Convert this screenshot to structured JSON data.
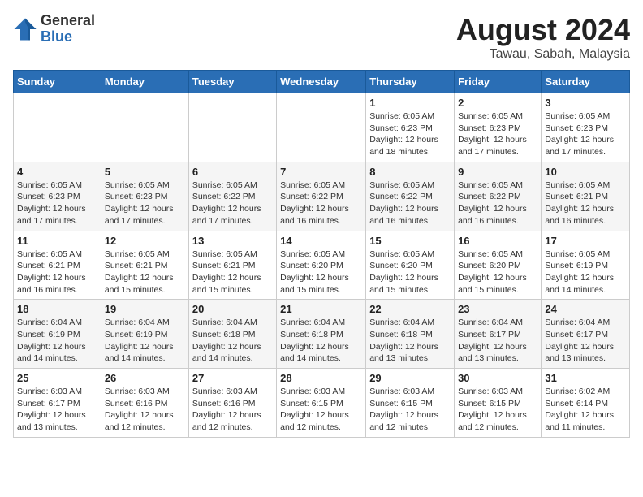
{
  "header": {
    "logo_general": "General",
    "logo_blue": "Blue",
    "main_title": "August 2024",
    "subtitle": "Tawau, Sabah, Malaysia"
  },
  "weekdays": [
    "Sunday",
    "Monday",
    "Tuesday",
    "Wednesday",
    "Thursday",
    "Friday",
    "Saturday"
  ],
  "weeks": [
    [
      {
        "day": "",
        "info": ""
      },
      {
        "day": "",
        "info": ""
      },
      {
        "day": "",
        "info": ""
      },
      {
        "day": "",
        "info": ""
      },
      {
        "day": "1",
        "info": "Sunrise: 6:05 AM\nSunset: 6:23 PM\nDaylight: 12 hours\nand 18 minutes."
      },
      {
        "day": "2",
        "info": "Sunrise: 6:05 AM\nSunset: 6:23 PM\nDaylight: 12 hours\nand 17 minutes."
      },
      {
        "day": "3",
        "info": "Sunrise: 6:05 AM\nSunset: 6:23 PM\nDaylight: 12 hours\nand 17 minutes."
      }
    ],
    [
      {
        "day": "4",
        "info": "Sunrise: 6:05 AM\nSunset: 6:23 PM\nDaylight: 12 hours\nand 17 minutes."
      },
      {
        "day": "5",
        "info": "Sunrise: 6:05 AM\nSunset: 6:23 PM\nDaylight: 12 hours\nand 17 minutes."
      },
      {
        "day": "6",
        "info": "Sunrise: 6:05 AM\nSunset: 6:22 PM\nDaylight: 12 hours\nand 17 minutes."
      },
      {
        "day": "7",
        "info": "Sunrise: 6:05 AM\nSunset: 6:22 PM\nDaylight: 12 hours\nand 16 minutes."
      },
      {
        "day": "8",
        "info": "Sunrise: 6:05 AM\nSunset: 6:22 PM\nDaylight: 12 hours\nand 16 minutes."
      },
      {
        "day": "9",
        "info": "Sunrise: 6:05 AM\nSunset: 6:22 PM\nDaylight: 12 hours\nand 16 minutes."
      },
      {
        "day": "10",
        "info": "Sunrise: 6:05 AM\nSunset: 6:21 PM\nDaylight: 12 hours\nand 16 minutes."
      }
    ],
    [
      {
        "day": "11",
        "info": "Sunrise: 6:05 AM\nSunset: 6:21 PM\nDaylight: 12 hours\nand 16 minutes."
      },
      {
        "day": "12",
        "info": "Sunrise: 6:05 AM\nSunset: 6:21 PM\nDaylight: 12 hours\nand 15 minutes."
      },
      {
        "day": "13",
        "info": "Sunrise: 6:05 AM\nSunset: 6:21 PM\nDaylight: 12 hours\nand 15 minutes."
      },
      {
        "day": "14",
        "info": "Sunrise: 6:05 AM\nSunset: 6:20 PM\nDaylight: 12 hours\nand 15 minutes."
      },
      {
        "day": "15",
        "info": "Sunrise: 6:05 AM\nSunset: 6:20 PM\nDaylight: 12 hours\nand 15 minutes."
      },
      {
        "day": "16",
        "info": "Sunrise: 6:05 AM\nSunset: 6:20 PM\nDaylight: 12 hours\nand 15 minutes."
      },
      {
        "day": "17",
        "info": "Sunrise: 6:05 AM\nSunset: 6:19 PM\nDaylight: 12 hours\nand 14 minutes."
      }
    ],
    [
      {
        "day": "18",
        "info": "Sunrise: 6:04 AM\nSunset: 6:19 PM\nDaylight: 12 hours\nand 14 minutes."
      },
      {
        "day": "19",
        "info": "Sunrise: 6:04 AM\nSunset: 6:19 PM\nDaylight: 12 hours\nand 14 minutes."
      },
      {
        "day": "20",
        "info": "Sunrise: 6:04 AM\nSunset: 6:18 PM\nDaylight: 12 hours\nand 14 minutes."
      },
      {
        "day": "21",
        "info": "Sunrise: 6:04 AM\nSunset: 6:18 PM\nDaylight: 12 hours\nand 14 minutes."
      },
      {
        "day": "22",
        "info": "Sunrise: 6:04 AM\nSunset: 6:18 PM\nDaylight: 12 hours\nand 13 minutes."
      },
      {
        "day": "23",
        "info": "Sunrise: 6:04 AM\nSunset: 6:17 PM\nDaylight: 12 hours\nand 13 minutes."
      },
      {
        "day": "24",
        "info": "Sunrise: 6:04 AM\nSunset: 6:17 PM\nDaylight: 12 hours\nand 13 minutes."
      }
    ],
    [
      {
        "day": "25",
        "info": "Sunrise: 6:03 AM\nSunset: 6:17 PM\nDaylight: 12 hours\nand 13 minutes."
      },
      {
        "day": "26",
        "info": "Sunrise: 6:03 AM\nSunset: 6:16 PM\nDaylight: 12 hours\nand 12 minutes."
      },
      {
        "day": "27",
        "info": "Sunrise: 6:03 AM\nSunset: 6:16 PM\nDaylight: 12 hours\nand 12 minutes."
      },
      {
        "day": "28",
        "info": "Sunrise: 6:03 AM\nSunset: 6:15 PM\nDaylight: 12 hours\nand 12 minutes."
      },
      {
        "day": "29",
        "info": "Sunrise: 6:03 AM\nSunset: 6:15 PM\nDaylight: 12 hours\nand 12 minutes."
      },
      {
        "day": "30",
        "info": "Sunrise: 6:03 AM\nSunset: 6:15 PM\nDaylight: 12 hours\nand 12 minutes."
      },
      {
        "day": "31",
        "info": "Sunrise: 6:02 AM\nSunset: 6:14 PM\nDaylight: 12 hours\nand 11 minutes."
      }
    ]
  ]
}
